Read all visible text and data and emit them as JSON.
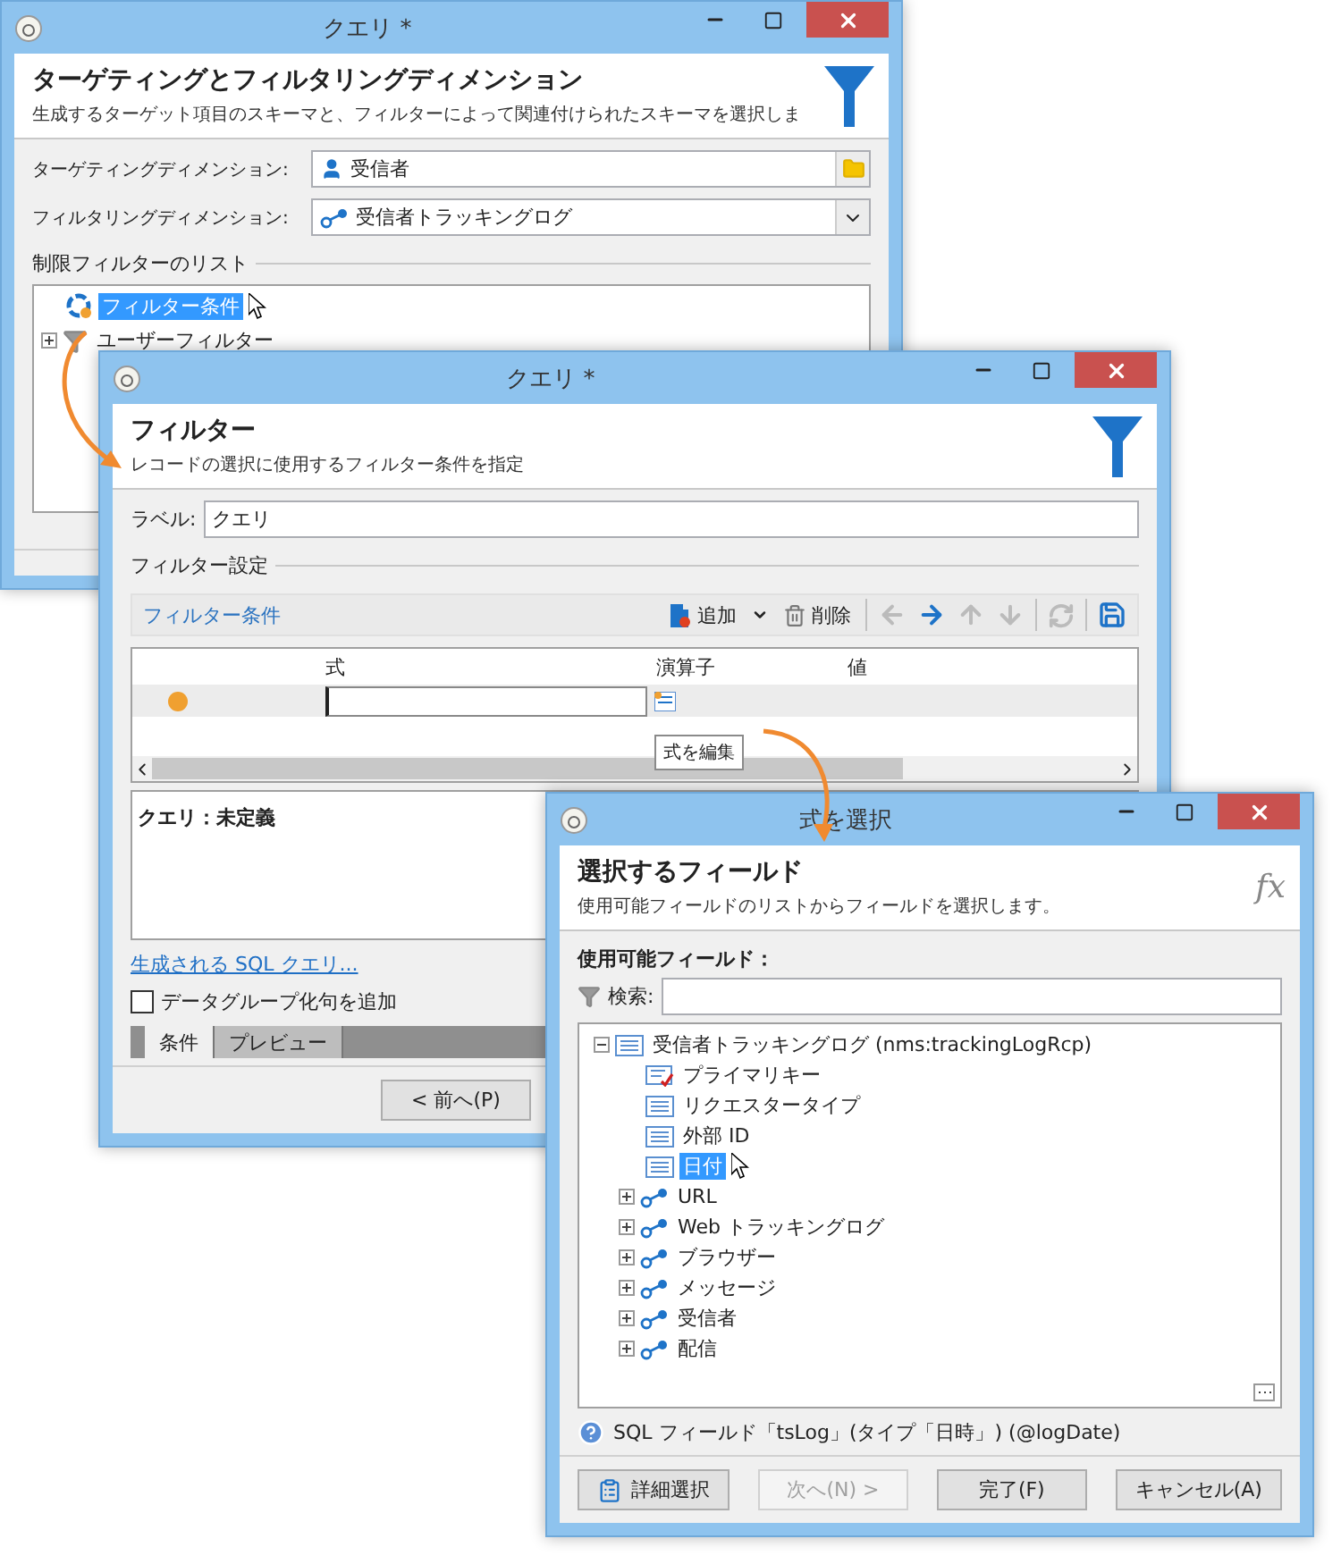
{
  "query_window": {
    "title": "クエリ *",
    "heading": "ターゲティングとフィルタリングディメンション",
    "description": "生成するターゲット項目のスキーマと、フィルターによって関連付けられたスキーマを選択しま",
    "targeting": {
      "label": "ターゲティングディメンション:",
      "value": "受信者"
    },
    "filtering": {
      "label": "フィルタリングディメンション:",
      "value": "受信者トラッキングログ"
    },
    "section": "制限フィルターのリスト",
    "tree": [
      {
        "label": "フィルター条件",
        "kind": "condition",
        "selected": true
      },
      {
        "label": "ユーザーフィルター",
        "kind": "group",
        "expanded": false,
        "selected": false
      }
    ]
  },
  "filter_window": {
    "title": "クエリ *",
    "heading": "フィルター",
    "description": "レコードの選択に使用するフィルター条件を指定",
    "label_field": {
      "label": "ラベル:",
      "value": "クエリ"
    },
    "section": "フィルター設定",
    "toolbar": {
      "title": "フィルター条件",
      "add": "追加",
      "delete": "削除"
    },
    "columns": [
      "式",
      "演算子",
      "値"
    ],
    "tooltip": "式を編集",
    "summary": "クエリ：未定義",
    "sql_link": "生成される SQL クエリ...",
    "group_checkbox": {
      "label": "データグループ化句を追加",
      "checked": false
    },
    "tabs": [
      {
        "label": "条件",
        "selected": true
      },
      {
        "label": "プレビュー",
        "selected": false
      }
    ],
    "back_button": "< 前へ(P)"
  },
  "expression_window": {
    "title": "式を選択",
    "heading": "選択するフィールド",
    "description": "使用可能フィールドのリストからフィールドを選択します。",
    "fx": "fx",
    "fields_label": "使用可能フィールド：",
    "search_label": "検索:",
    "tree": {
      "label": "受信者トラッキングログ (nms:trackingLogRcp)",
      "expanded": true,
      "children": [
        {
          "label": "プライマリキー",
          "kind": "key",
          "selected": false
        },
        {
          "label": "リクエスタータイプ",
          "kind": "field",
          "selected": false
        },
        {
          "label": "外部 ID",
          "kind": "field",
          "selected": false
        },
        {
          "label": "日付",
          "kind": "field",
          "selected": true
        },
        {
          "label": "URL",
          "kind": "link",
          "expanded": false,
          "selected": false
        },
        {
          "label": "Web トラッキングログ",
          "kind": "link",
          "expanded": false,
          "selected": false
        },
        {
          "label": "ブラウザー",
          "kind": "link",
          "expanded": false,
          "selected": false
        },
        {
          "label": "メッセージ",
          "kind": "link",
          "expanded": false,
          "selected": false
        },
        {
          "label": "受信者",
          "kind": "link",
          "expanded": false,
          "selected": false
        },
        {
          "label": "配信",
          "kind": "link",
          "expanded": false,
          "selected": false
        }
      ]
    },
    "info": "SQL フィールド「tsLog」(タイプ「日時」) (@logDate)",
    "buttons": [
      {
        "label": "詳細選択",
        "kind": "select",
        "disabled": false
      },
      {
        "label": "次へ(N) >",
        "kind": "plain",
        "disabled": true
      },
      {
        "label": "完了(F)",
        "kind": "plain",
        "disabled": false
      },
      {
        "label": "キャンセル(A)",
        "kind": "plain",
        "disabled": false
      }
    ]
  }
}
